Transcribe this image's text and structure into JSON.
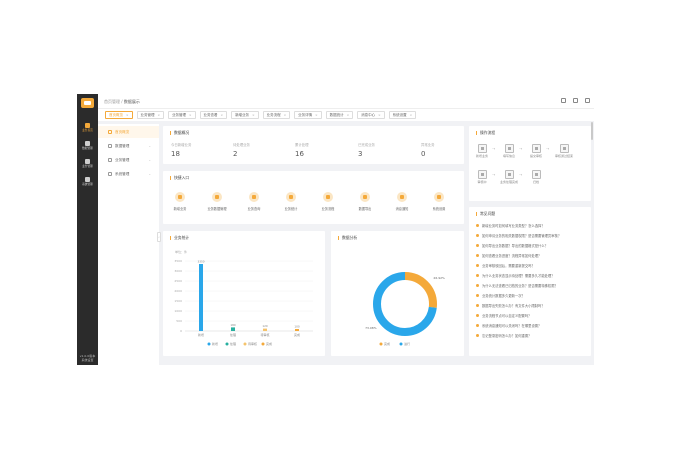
{
  "rail": {
    "items": [
      {
        "label": "业务首页",
        "icon": "home-icon"
      },
      {
        "label": "数据管理",
        "icon": "data-icon"
      },
      {
        "label": "业务管理",
        "icon": "business-icon"
      },
      {
        "label": "系统管理",
        "icon": "settings-icon"
      }
    ],
    "footer": "v1.0.0版本 系统设置"
  },
  "breadcrumb": {
    "parent": "首页管理",
    "current": "数据展示"
  },
  "top_icons": [
    "notification-icon",
    "fullscreen-icon",
    "user-icon"
  ],
  "tabs": [
    {
      "label": "首页概览"
    },
    {
      "label": "业务管理"
    },
    {
      "label": "业务管理"
    },
    {
      "label": "业务查看"
    },
    {
      "label": "新增业务"
    },
    {
      "label": "业务流程"
    },
    {
      "label": "业务详情"
    },
    {
      "label": "数据统计"
    },
    {
      "label": "消息中心"
    },
    {
      "label": "系统设置"
    }
  ],
  "menu": {
    "items": [
      {
        "label": "首页概览"
      },
      {
        "label": "数据管理"
      },
      {
        "label": "业务管理"
      },
      {
        "label": "系统管理"
      }
    ]
  },
  "stats": {
    "title": "数据概况",
    "items": [
      {
        "label": "今日新增业务",
        "value": "18"
      },
      {
        "label": "待处理业务",
        "value": "2"
      },
      {
        "label": "累计处理",
        "value": "16"
      },
      {
        "label": "已完成业务",
        "value": "3"
      },
      {
        "label": "异常业务",
        "value": "0"
      }
    ]
  },
  "quick": {
    "title": "快捷入口",
    "items": [
      {
        "label": "新增业务",
        "icon": "add-icon"
      },
      {
        "label": "业务数据管理",
        "icon": "manage-icon"
      },
      {
        "label": "业务查询",
        "icon": "query-icon"
      },
      {
        "label": "业务统计",
        "icon": "stats-icon"
      },
      {
        "label": "业务流程",
        "icon": "flow-icon"
      },
      {
        "label": "数据导出",
        "icon": "export-icon"
      },
      {
        "label": "消息通知",
        "icon": "notice-icon"
      },
      {
        "label": "系统设置",
        "icon": "gear-icon"
      }
    ]
  },
  "flow": {
    "title": "操作流程",
    "steps": [
      "新增业务",
      "填写信息",
      "提交审核",
      "审核通过结束",
      "审核中",
      "业务处理完成",
      "归档"
    ]
  },
  "faq": {
    "title": "常见问题",
    "items": [
      "新增业务时如何填写业务类型？怎么选择？",
      "如何申请业务的相关数据权限？是否需要管理员审核？",
      "如何导出业务数据？导出的数据格式是什么？",
      "如何查看业务进度？流程异常如何处理？",
      "业务审核驳回后，需要重新提交吗？",
      "为什么业务状态显示待处理？需要多久才能处理？",
      "为什么无法查看已归档的业务？是否需要特殊权限？",
      "业务统计数据多久更新一次？",
      "数据导出失败怎么办？有文件大小限制吗？",
      "业务流程节点可以自定义配置吗？",
      "系统消息通知可以关闭吗？在哪里设置？",
      "忘记登录密码怎么办？如何重置？"
    ]
  },
  "chart_data": [
    {
      "type": "bar",
      "title": "业务统计",
      "ylabel": "单位：件",
      "categories": [
        "新增",
        "处理",
        "待审核",
        "完成"
      ],
      "series": [
        {
          "name": "新增",
          "color": "#2aa7ea",
          "values": [
            3350,
            0,
            0,
            0
          ]
        },
        {
          "name": "处理",
          "color": "#27b0a0",
          "values": [
            0,
            180,
            0,
            0
          ]
        },
        {
          "name": "待审核",
          "color": "#f5c36b",
          "values": [
            0,
            0,
            120,
            0
          ]
        },
        {
          "name": "完成",
          "color": "#f4a93a",
          "values": [
            0,
            0,
            0,
            100
          ]
        }
      ],
      "ylim": [
        0,
        3500
      ],
      "yticks": [
        0,
        500,
        1000,
        1500,
        2000,
        2500,
        3000,
        3500
      ],
      "legend": "bottom"
    },
    {
      "type": "pie",
      "title": "数据分析",
      "slices": [
        {
          "label": "完成",
          "value": 26.9,
          "display": "26.92%",
          "color": "#f4a93a"
        },
        {
          "label": "进行",
          "value": 73.1,
          "display": "73.08%",
          "color": "#2aa7ea"
        }
      ],
      "legend": "bottom"
    }
  ]
}
